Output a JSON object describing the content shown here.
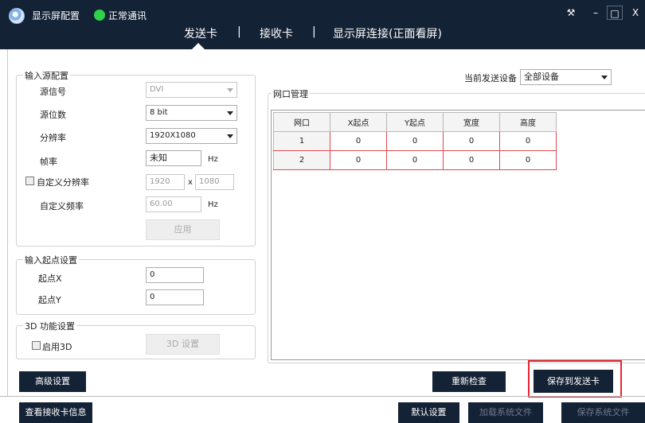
{
  "titlebar": {
    "app_title": "显示屏配置",
    "status_text": "正常通讯",
    "tabs": [
      {
        "label": "发送卡"
      },
      {
        "label": "接收卡"
      },
      {
        "label": "显示屏连接(正面看屏)"
      }
    ],
    "separator": "|",
    "window_buttons": {
      "tool": "⚒",
      "minimize": "–",
      "maximize": "□",
      "close": "X"
    }
  },
  "input_source": {
    "title": "输入源配置",
    "signal_label": "源信号",
    "signal_value": "DVI",
    "bit_label": "源位数",
    "bit_value": "8 bit",
    "resolution_label": "分辨率",
    "resolution_value": "1920X1080",
    "framerate_label": "帧率",
    "framerate_value": "未知",
    "framerate_unit": "Hz",
    "custom_res_label": "自定义分辨率",
    "custom_width": "1920",
    "custom_x": "x",
    "custom_height": "1080",
    "custom_freq_label": "自定义频率",
    "custom_freq_value": "60.00",
    "custom_freq_unit": "Hz",
    "apply_label": "应用"
  },
  "start_point": {
    "title": "输入起点设置",
    "x_label": "起点X",
    "x_value": "0",
    "y_label": "起点Y",
    "y_value": "0"
  },
  "three_d": {
    "title": "3D 功能设置",
    "enable_label": "启用3D",
    "settings_label": "3D 设置"
  },
  "device": {
    "label": "当前发送设备",
    "value": "全部设备"
  },
  "network": {
    "title": "网口管理",
    "columns": [
      "网口",
      "X起点",
      "Y起点",
      "宽度",
      "高度"
    ],
    "rows": [
      [
        "1",
        "0",
        "0",
        "0",
        "0"
      ],
      [
        "2",
        "0",
        "0",
        "0",
        "0"
      ]
    ]
  },
  "buttons": {
    "advanced": "高级设置",
    "recheck": "重新检查",
    "save_to_card": "保存到发送卡",
    "view_receiver": "查看接收卡信息",
    "default_settings": "默认设置",
    "load_system_file": "加载系统文件",
    "save_system_file": "保存系统文件"
  },
  "colors": {
    "titlebar": "#142235",
    "status_green": "#2fd04a",
    "highlight_red": "#e8242f"
  }
}
